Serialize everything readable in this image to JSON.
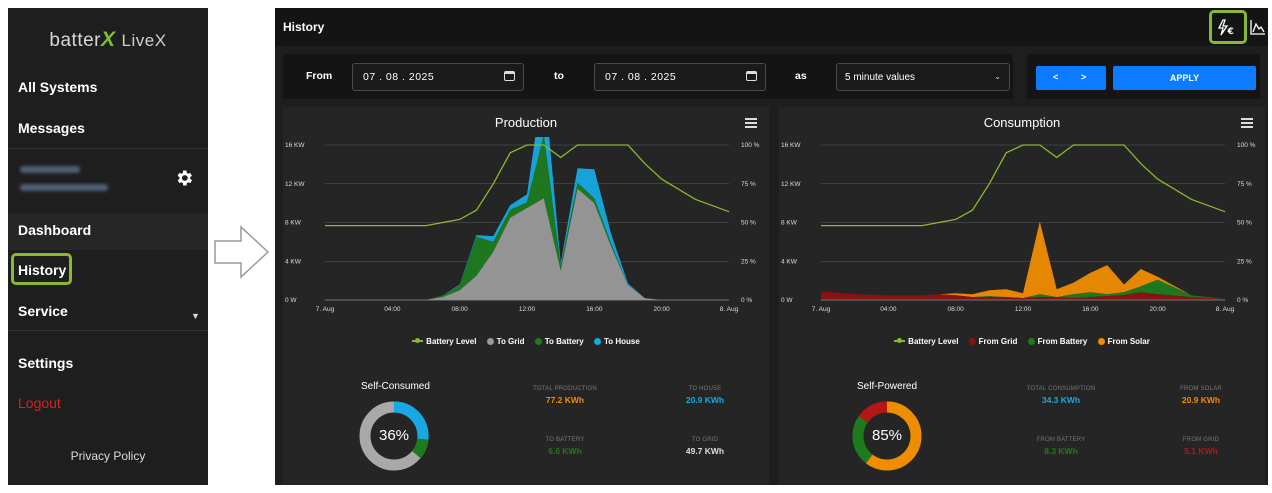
{
  "colors": {
    "accent_green": "#8ab832",
    "battery_level": "#8ab832",
    "to_grid": "#9a9a9a",
    "to_battery": "#1d7a1d",
    "to_house": "#16a9e3",
    "from_grid": "#8b1111",
    "from_battery": "#1d7a1d",
    "from_solar": "#ef8c00",
    "button_blue": "#0d7bff",
    "logout_red": "#e01f1f"
  },
  "sidebar": {
    "logo": {
      "brand": "batter",
      "x": "X",
      "suffix": "LiveX"
    },
    "items": [
      {
        "label": "All Systems"
      },
      {
        "label": "Messages"
      },
      {
        "label": "Dashboard"
      },
      {
        "label": "History"
      },
      {
        "label": "Service"
      },
      {
        "label": "Settings"
      },
      {
        "label": "Logout"
      }
    ],
    "icons": {
      "settings": "gear-icon",
      "service_caret": "caret-down-icon"
    },
    "privacy": "Privacy Policy"
  },
  "header": {
    "title": "History",
    "icons": [
      "energy-cost-icon",
      "chart-icon"
    ]
  },
  "filter": {
    "from_label": "From",
    "from_value": "07 . 08 . 2025",
    "to_label": "to",
    "to_value": "07 . 08 . 2025",
    "as_label": "as",
    "as_value": "5 minute values",
    "prev": "<",
    "next": ">",
    "apply": "APPLY"
  },
  "production": {
    "title": "Production",
    "legend": [
      "Battery Level",
      "To Grid",
      "To Battery",
      "To House"
    ],
    "ring_title": "Self-Consumed",
    "ring_pct": "36%",
    "stats": [
      {
        "label": "TOTAL PRODUCTION",
        "value": "77.2 KWh"
      },
      {
        "label": "TO HOUSE",
        "value": "20.9 KWh"
      },
      {
        "label": "TO BATTERY",
        "value": "6.6 KWh"
      },
      {
        "label": "TO GRID",
        "value": "49.7 KWh"
      }
    ]
  },
  "consumption": {
    "title": "Consumption",
    "legend": [
      "Battery Level",
      "From Grid",
      "From Battery",
      "From Solar"
    ],
    "ring_title": "Self-Powered",
    "ring_pct": "85%",
    "stats": [
      {
        "label": "TOTAL CONSUMPTION",
        "value": "34.3 KWh"
      },
      {
        "label": "FROM SOLAR",
        "value": "20.9 KWh"
      },
      {
        "label": "FROM BATTERY",
        "value": "8.3 KWh"
      },
      {
        "label": "FROM GRID",
        "value": "5.1 KWh"
      }
    ]
  },
  "axes": {
    "y_left": [
      "16 KW",
      "12 KW",
      "8 KW",
      "4 KW",
      "0 W"
    ],
    "y_right": [
      "100 %",
      "75 %",
      "50 %",
      "25 %",
      "0 %"
    ],
    "x": [
      "7. Aug",
      "04:00",
      "08:00",
      "12:00",
      "16:00",
      "20:00",
      "8. Aug"
    ]
  },
  "chart_data": [
    {
      "type": "area",
      "title": "Production",
      "x": [
        "00:00",
        "02:00",
        "04:00",
        "06:00",
        "07:00",
        "08:00",
        "09:00",
        "10:00",
        "11:00",
        "12:00",
        "13:00",
        "14:00",
        "15:00",
        "16:00",
        "17:00",
        "18:00",
        "19:00",
        "20:00",
        "22:00",
        "24:00"
      ],
      "ylim": [
        0,
        16
      ],
      "series": [
        {
          "name": "To Grid",
          "unit": "KW",
          "values": [
            0,
            0,
            0,
            0,
            0.3,
            1.0,
            2.5,
            5.0,
            8.5,
            9.5,
            10.5,
            3.0,
            11.5,
            10.0,
            5.5,
            1.5,
            0.2,
            0,
            0,
            0
          ]
        },
        {
          "name": "To Battery",
          "unit": "KW",
          "values": [
            0,
            0,
            0,
            0,
            0.2,
            0.5,
            4.0,
            1.0,
            0.8,
            0.6,
            6.5,
            0.5,
            0.6,
            0.5,
            0.3,
            0,
            0,
            0,
            0,
            0
          ]
        },
        {
          "name": "To House",
          "unit": "KW",
          "values": [
            0,
            0,
            0,
            0,
            0,
            0.1,
            0.2,
            0.6,
            0.5,
            0.8,
            6.0,
            0.3,
            1.5,
            3.0,
            1.0,
            0.2,
            0,
            0,
            0,
            0
          ]
        },
        {
          "name": "Battery Level",
          "unit": "%",
          "values": [
            48,
            48,
            48,
            48,
            50,
            52,
            58,
            75,
            95,
            100,
            100,
            92,
            100,
            100,
            100,
            100,
            88,
            78,
            65,
            57
          ]
        }
      ]
    },
    {
      "type": "area",
      "title": "Consumption",
      "x": [
        "00:00",
        "02:00",
        "04:00",
        "06:00",
        "07:00",
        "08:00",
        "09:00",
        "10:00",
        "11:00",
        "12:00",
        "13:00",
        "14:00",
        "15:00",
        "16:00",
        "17:00",
        "18:00",
        "19:00",
        "20:00",
        "22:00",
        "24:00"
      ],
      "ylim": [
        0,
        16
      ],
      "series": [
        {
          "name": "From Grid",
          "unit": "KW",
          "values": [
            0.9,
            0.6,
            0.5,
            0.5,
            0.6,
            0.5,
            0.3,
            0.3,
            0.3,
            0.2,
            0.3,
            0.3,
            0.2,
            0.3,
            0.4,
            0.5,
            0.8,
            0.6,
            0.3,
            0.1
          ]
        },
        {
          "name": "From Battery",
          "unit": "KW",
          "values": [
            0,
            0,
            0,
            0,
            0,
            0,
            0,
            0.1,
            0,
            0,
            0.3,
            0,
            0.4,
            0.5,
            0.2,
            0.3,
            0.6,
            1.5,
            0.2,
            0
          ]
        },
        {
          "name": "From Solar",
          "unit": "KW",
          "values": [
            0,
            0,
            0,
            0,
            0,
            0.2,
            0.3,
            0.6,
            0.8,
            0.5,
            7.5,
            0.8,
            1.2,
            2.0,
            3.0,
            0.8,
            1.8,
            0.3,
            0,
            0
          ]
        },
        {
          "name": "Battery Level",
          "unit": "%",
          "values": [
            48,
            48,
            48,
            48,
            50,
            52,
            58,
            75,
            95,
            100,
            100,
            92,
            100,
            100,
            100,
            100,
            88,
            78,
            65,
            57
          ]
        }
      ]
    }
  ]
}
